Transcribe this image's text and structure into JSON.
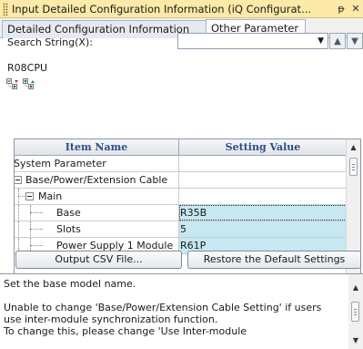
{
  "window": {
    "title": "Input Detailed Configuration Information (iQ Configurat...",
    "pin_glyph": "ᵽ",
    "close_glyph": "✕"
  },
  "tabs": [
    {
      "label": "Detailed Configuration Information",
      "active": false
    },
    {
      "label": "Other Parameter",
      "active": true
    }
  ],
  "search": {
    "label": "Search String(X):",
    "value": "",
    "dropdown_glyph": "▼",
    "up_glyph": "▲",
    "down_glyph": "▼"
  },
  "cpu_label": "R08CPU",
  "toolbar": {
    "icons": [
      "expand-all-icon",
      "collapse-all-icon"
    ]
  },
  "grid": {
    "headers": [
      "Item Name",
      "Setting Value"
    ],
    "rows": [
      {
        "name": "System Parameter",
        "value": "",
        "level": 0
      },
      {
        "name": "Base/Power/Extension Cable",
        "value": "",
        "level": 1
      },
      {
        "name": "Main",
        "value": "",
        "level": 2
      },
      {
        "name": "Base",
        "value": "R35B",
        "level": 3
      },
      {
        "name": "Slots",
        "value": "5",
        "level": 3
      },
      {
        "name": "Power Supply 1 Module",
        "value": "R61P",
        "level": 3
      }
    ]
  },
  "buttons": {
    "output_csv": "Output CSV File...",
    "restore_defaults": "Restore the Default Settings"
  },
  "description": {
    "line1": "Set the base model name.",
    "line2": "Unable to change 'Base/Power/Extension Cable Setting' if users use inter-module synchronization function.",
    "line3": "To change this, please change 'Use Inter-module"
  },
  "colors": {
    "titlebar": "#fde9a8",
    "value_cell": "#c6e8f0",
    "header_text": "#2b4d8a"
  }
}
